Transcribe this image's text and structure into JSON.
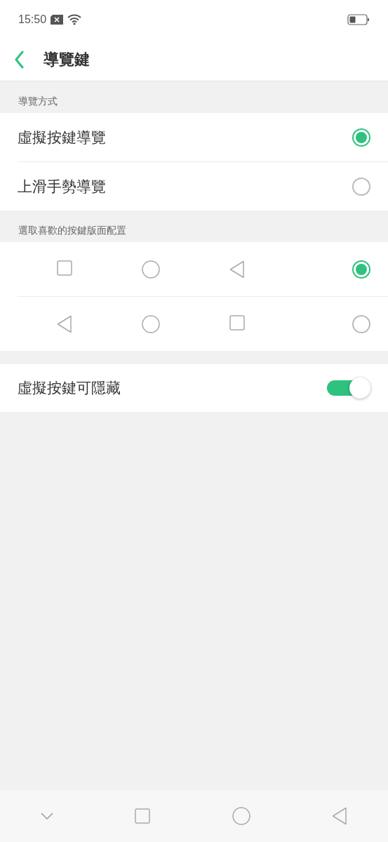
{
  "status_bar": {
    "time": "15:50"
  },
  "header": {
    "title": "導覽鍵"
  },
  "navigation_section": {
    "label": "導覽方式",
    "options": [
      {
        "label": "虛擬按鍵導覽",
        "selected": true
      },
      {
        "label": "上滑手勢導覽",
        "selected": false
      }
    ]
  },
  "layout_section": {
    "label": "選取喜歡的按鍵版面配置",
    "layouts": [
      {
        "keys": [
          {
            "kind": "square"
          },
          {
            "kind": "circle"
          },
          {
            "kind": "triangle"
          }
        ],
        "selected": true
      },
      {
        "keys": [
          {
            "kind": "triangle"
          },
          {
            "kind": "circle"
          },
          {
            "kind": "square"
          }
        ],
        "selected": false
      }
    ]
  },
  "hide_setting": {
    "label": "虛擬按鍵可隱藏",
    "on": true
  }
}
